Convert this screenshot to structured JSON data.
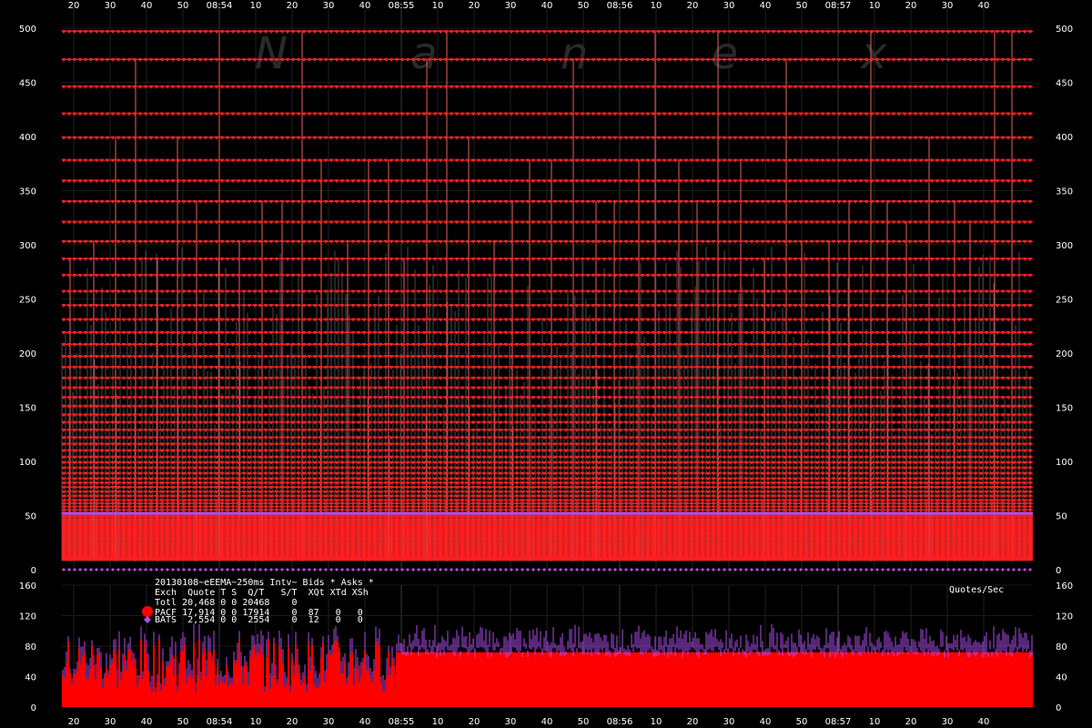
{
  "watermark": "N a n e x",
  "x_ticks": [
    "20",
    "30",
    "40",
    "50",
    "08:54",
    "10",
    "20",
    "30",
    "40",
    "08:55",
    "10",
    "20",
    "30",
    "40",
    "50",
    "08:56",
    "10",
    "20",
    "30",
    "40",
    "50",
    "08:57",
    "10",
    "20",
    "30",
    "40"
  ],
  "legend": {
    "title": "20130108~eEEMA~250ms Intv~ Bids * Asks *",
    "header": "Exch  Quote T S  Q/T   S/T  XQt XTd XSh",
    "rows": [
      {
        "text": "Totl 20,468 0 0 20468    0",
        "marker": "none"
      },
      {
        "text": "PACF 17,914 0 0 17914    0  87   0   0",
        "marker": "circle"
      },
      {
        "text": "BATS  2,554 0 0  2554    0  12   0   0",
        "marker": "diamond"
      }
    ],
    "quotes_label": "Quotes/Sec"
  },
  "chart_data": [
    {
      "type": "scatter",
      "title": "",
      "xlabel": "",
      "ylabel": "",
      "x_ticks": [
        "20",
        "30",
        "40",
        "50",
        "08:54",
        "10",
        "20",
        "30",
        "40",
        "08:55",
        "10",
        "20",
        "30",
        "40",
        "50",
        "08:56",
        "10",
        "20",
        "30",
        "40",
        "50",
        "08:57",
        "10",
        "20",
        "30",
        "40"
      ],
      "y_ticks": [
        0,
        50,
        100,
        150,
        200,
        250,
        300,
        350,
        400,
        450,
        500
      ],
      "ylim": [
        0,
        500
      ],
      "grid": true,
      "series": [
        {
          "name": "PACF",
          "color": "#ff2020",
          "marker": "triangle-down",
          "ask_levels": [
            497,
            471,
            446,
            421,
            399,
            378,
            359,
            340,
            321,
            303,
            287,
            272,
            257,
            244,
            231,
            219,
            208,
            197,
            187,
            177,
            168,
            159,
            151,
            143,
            136,
            129,
            122,
            116,
            110,
            104,
            99,
            94,
            89,
            84,
            80,
            76,
            72,
            68,
            64,
            61,
            58,
            55,
            52,
            49,
            46,
            44,
            42,
            40,
            38,
            36,
            34,
            32,
            30,
            28,
            26,
            24,
            22,
            20,
            18,
            16,
            14,
            12,
            10
          ],
          "spike_peaks": [
            497,
            471,
            399,
            378,
            340,
            321,
            303,
            287
          ],
          "bid_level": 10
        },
        {
          "name": "BATS",
          "color": "#b04cf0",
          "marker": "diamond",
          "ask_level": 52,
          "bid_level": 0
        }
      ]
    },
    {
      "type": "bar",
      "title": "",
      "xlabel": "",
      "ylabel": "Quotes/Sec",
      "ylim": [
        0,
        160
      ],
      "y_ticks": [
        0,
        40,
        80,
        120,
        160
      ],
      "grid": true,
      "series": [
        {
          "name": "PACF",
          "color": "#ff0000",
          "segments": [
            {
              "from_tick": "20",
              "to_tick": "50",
              "typical": 55,
              "range": [
                20,
                90
              ]
            },
            {
              "from_tick": "50",
              "to_tick": "40",
              "typical": 72,
              "range": [
                65,
                80
              ]
            }
          ]
        },
        {
          "name": "BATS",
          "color": "#b04cf0",
          "typical_top": 88,
          "range": [
            70,
            110
          ]
        }
      ]
    }
  ]
}
